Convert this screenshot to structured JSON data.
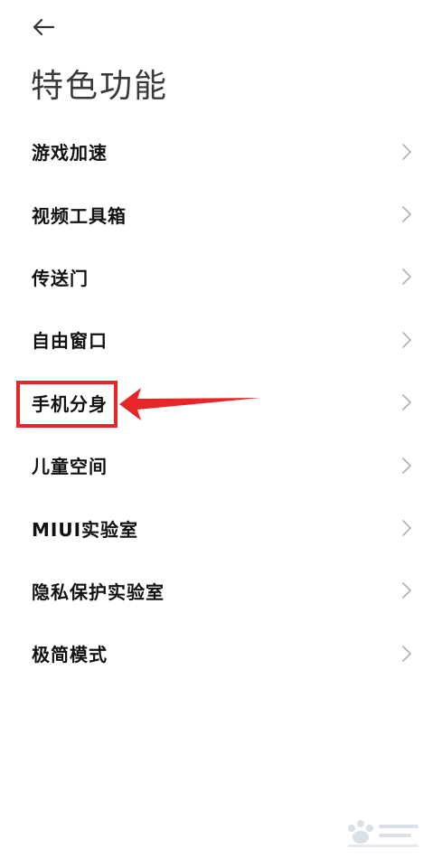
{
  "header": {
    "back_icon": "arrow-left-icon",
    "title": "特色功能"
  },
  "menu": {
    "chevron_icon": "chevron-right-icon",
    "items": [
      {
        "label": "游戏加速"
      },
      {
        "label": "视频工具箱"
      },
      {
        "label": "传送门"
      },
      {
        "label": "自由窗口"
      },
      {
        "label": "手机分身"
      },
      {
        "label": "儿童空间"
      },
      {
        "label": "MIUI实验室"
      },
      {
        "label": "隐私保护实验室"
      },
      {
        "label": "极简模式"
      }
    ]
  },
  "annotation": {
    "highlighted_item": "手机分身",
    "color": "#e8262a"
  },
  "colors": {
    "background": "#ffffff",
    "title": "#3a3a3a",
    "label": "#111111",
    "chevron": "#b5b5b5"
  }
}
